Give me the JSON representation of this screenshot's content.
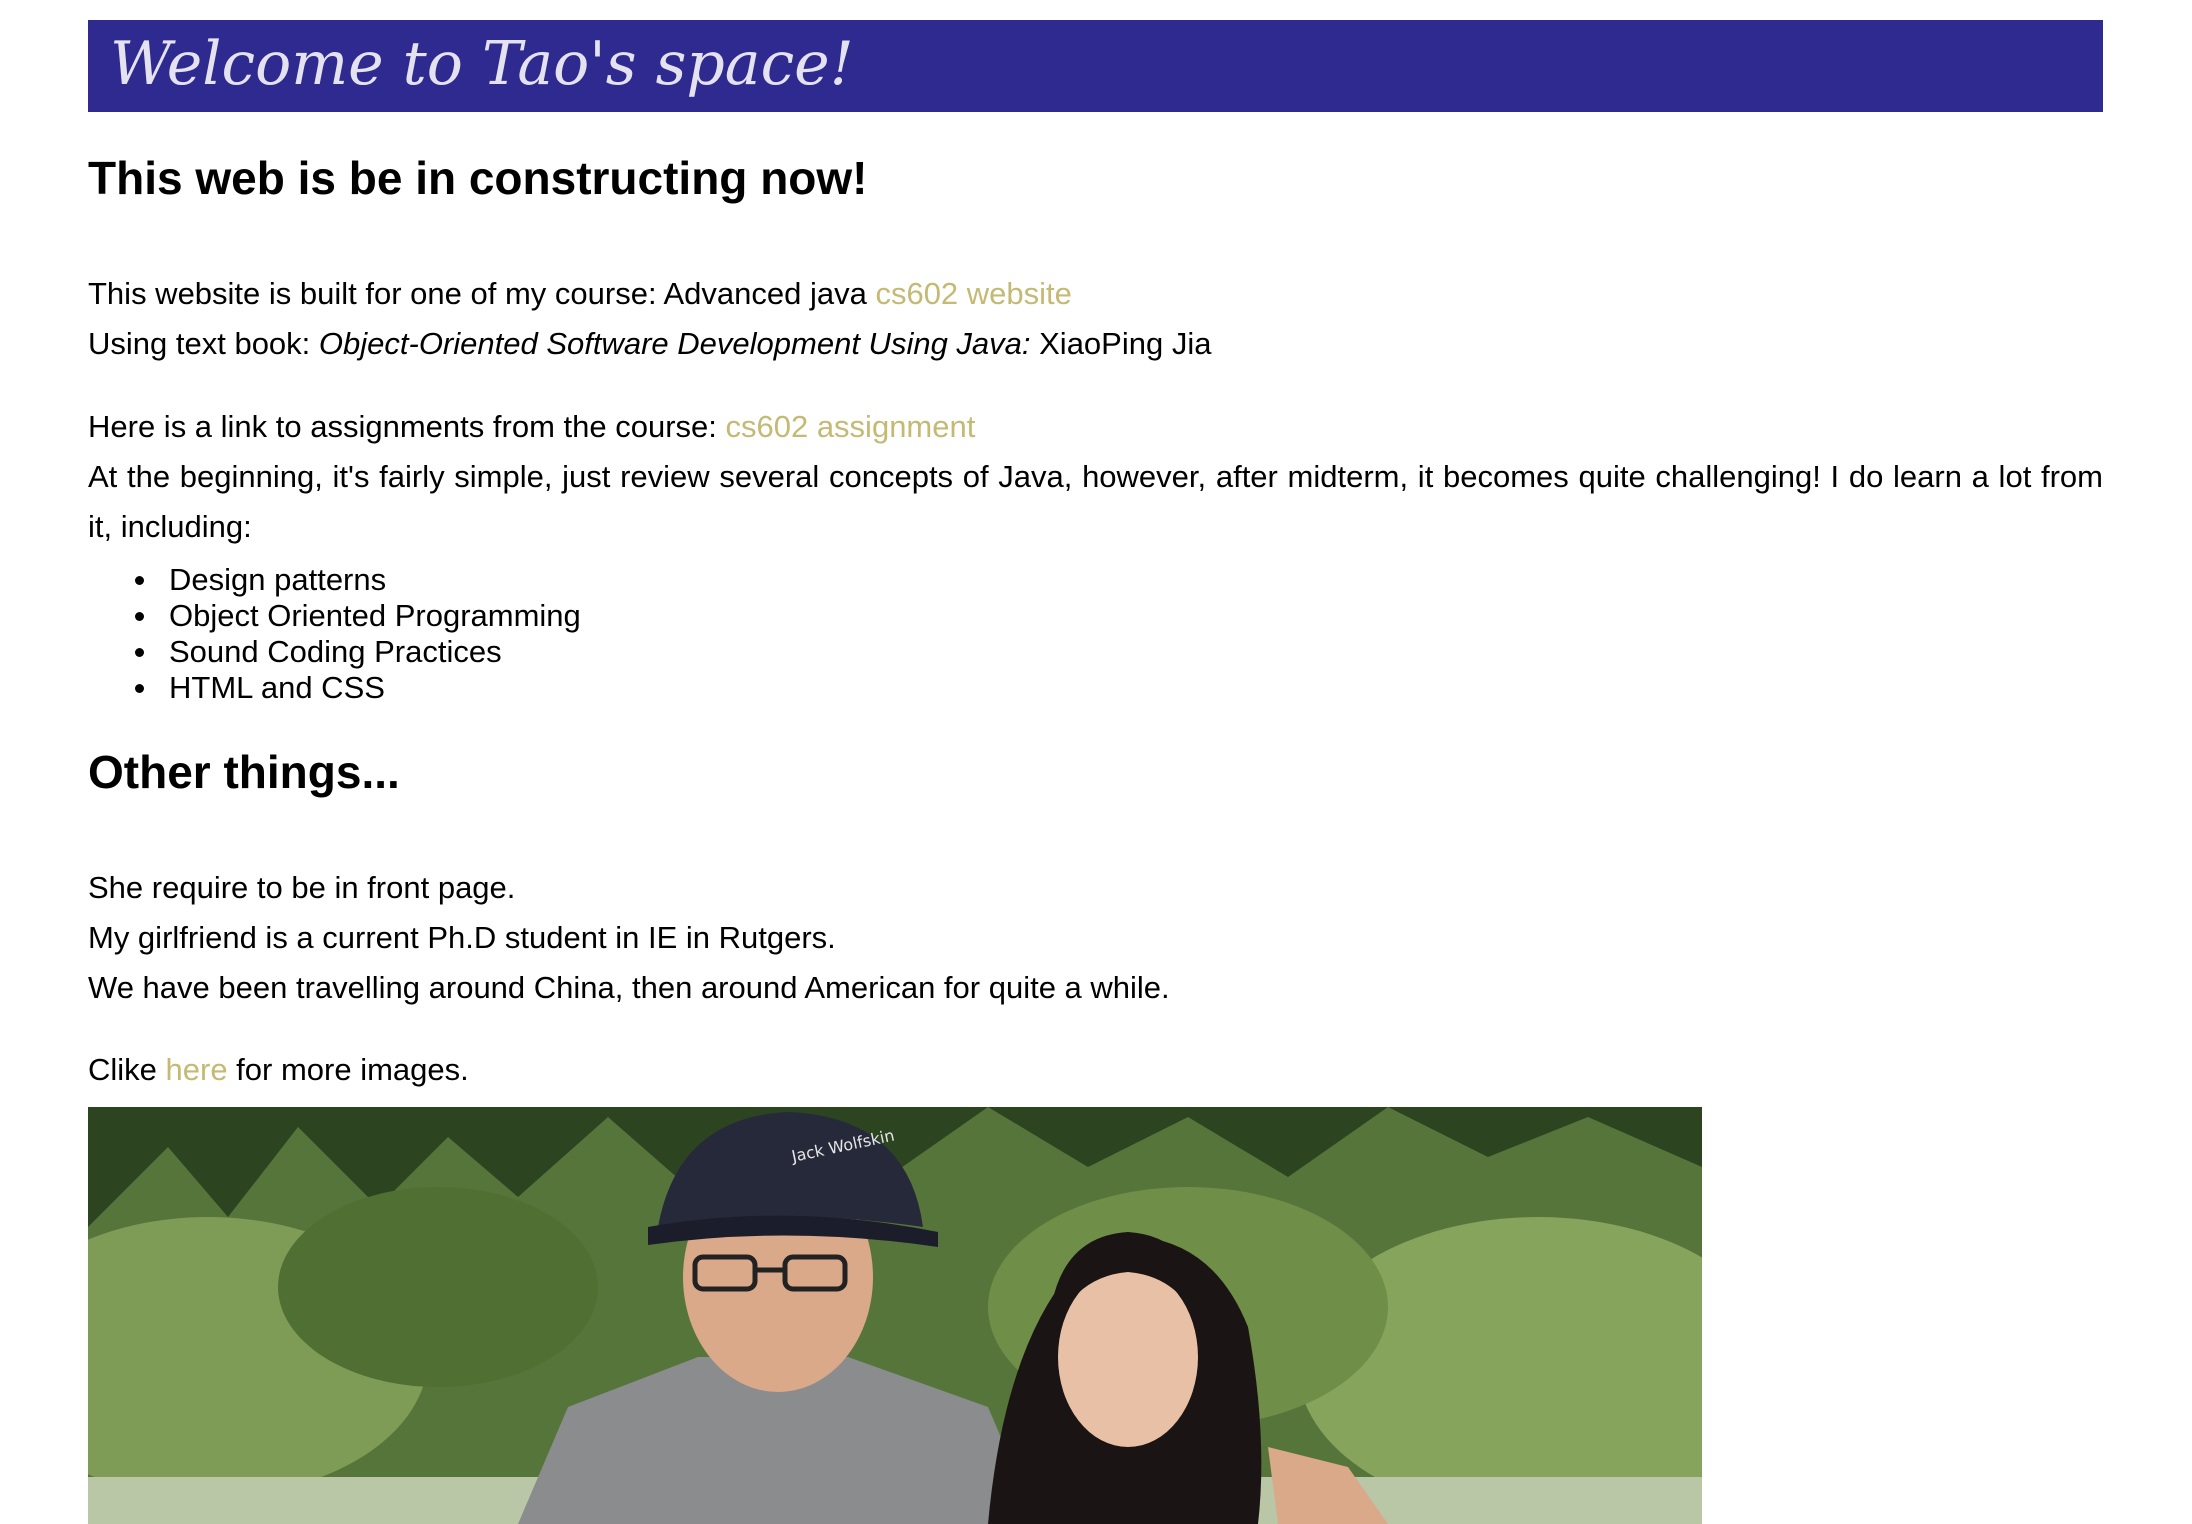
{
  "header": {
    "title": "Welcome to Tao's space!"
  },
  "intro": {
    "heading": "This web is be in constructing now!",
    "course_line_text": "This website is built for one of my course: Advanced java ",
    "course_link_label": "cs602 website",
    "textbook_prefix": "Using text book: ",
    "textbook_title": "Object-Oriented Software Development Using Java:",
    "textbook_author": " XiaoPing Jia",
    "assignment_line_text": "Here is a link to assignments from the course: ",
    "assignment_link_label": "cs602 assignment",
    "description": "At the beginning, it's fairly simple, just review several concepts of Java, however, after midterm, it becomes quite challenging! I do learn a lot from it, including:",
    "skills": [
      "Design patterns",
      "Object Oriented Programming",
      "Sound Coding Practices",
      "HTML and CSS"
    ]
  },
  "other": {
    "heading": "Other things...",
    "lines": [
      "She require to be in front page.",
      "My girlfriend is a current Ph.D student in IE in Rutgers.",
      "We have been travelling around China, then around American for quite a while."
    ],
    "images_prefix": "Clike ",
    "images_link_label": "here",
    "images_suffix": " for more images."
  },
  "photo": {
    "cap_text": "Jack Wolfskin"
  },
  "colors": {
    "banner_background": "#2e2a8f",
    "banner_text": "#e4e2ee",
    "link": "#c4ba74"
  }
}
